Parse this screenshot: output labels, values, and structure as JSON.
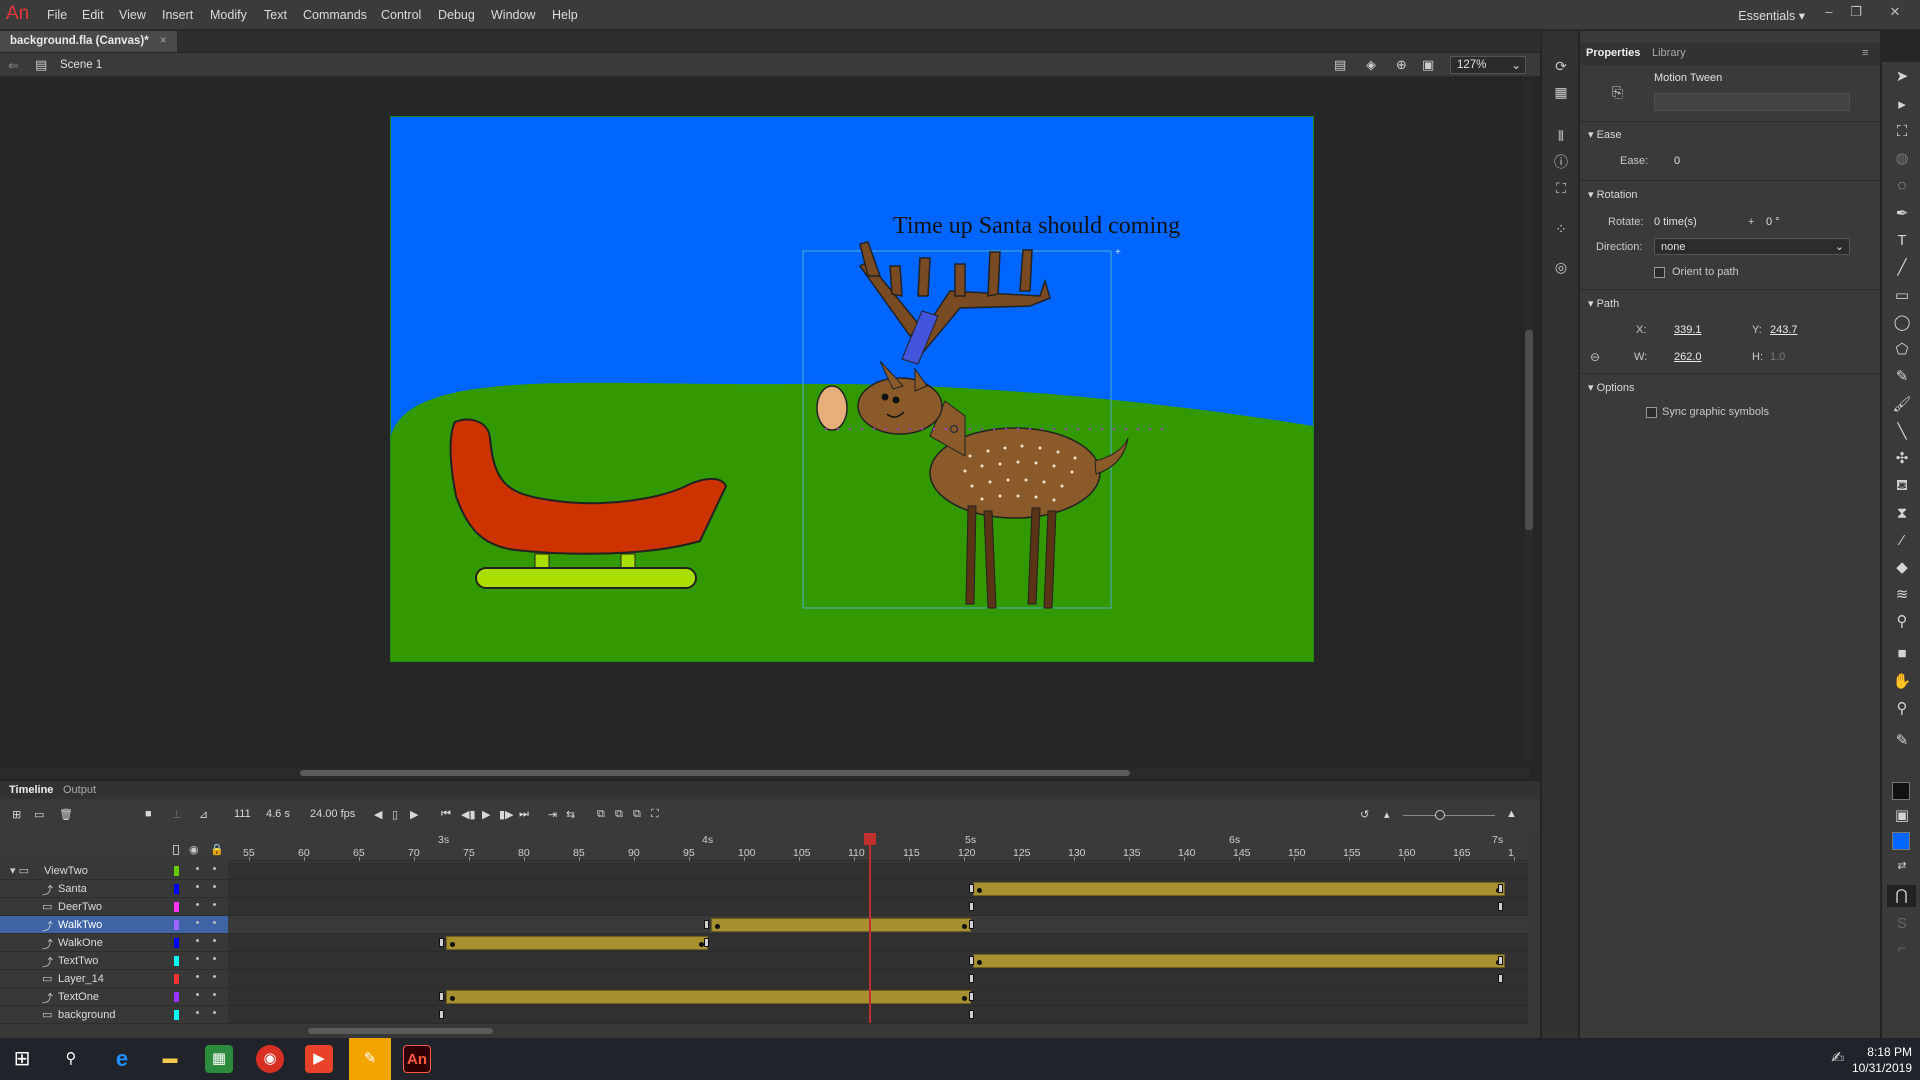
{
  "app": {
    "logo": "An",
    "menu": [
      "File",
      "Edit",
      "View",
      "Insert",
      "Modify",
      "Text",
      "Commands",
      "Control",
      "Debug",
      "Window",
      "Help"
    ],
    "workspace": "Essentials",
    "workspace_caret": "▾"
  },
  "document": {
    "tab_title": "background.fla (Canvas)*",
    "tab_close": "×",
    "scene": "Scene 1",
    "zoom": "127%"
  },
  "stage": {
    "text": "Time up Santa should coming",
    "colors": {
      "sky": "#0066ff",
      "grass": "#339900",
      "sleigh": "#cc3300",
      "runner": "#aadd00",
      "deer": "#8b5a2b",
      "antler": "#6b4423"
    }
  },
  "properties": {
    "tabs": [
      "Properties",
      "Library"
    ],
    "tween_type": "Motion Tween",
    "ease": {
      "section": "Ease",
      "label": "Ease:",
      "value": "0"
    },
    "rotation": {
      "section": "Rotation",
      "rotate_label": "Rotate:",
      "rotate_value": "0 time(s)",
      "plus": "+",
      "degree_value": "0 °",
      "direction_label": "Direction:",
      "direction_value": "none",
      "orient_label": "Orient to path"
    },
    "path": {
      "section": "Path",
      "x_label": "X:",
      "x_value": "339.1",
      "y_label": "Y:",
      "y_value": "243.7",
      "w_label": "W:",
      "w_value": "262.0",
      "h_label": "H:",
      "h_value": "1.0"
    },
    "options": {
      "section": "Options",
      "sync_label": "Sync graphic symbols"
    }
  },
  "timeline": {
    "tabs": [
      "Timeline",
      "Output"
    ],
    "current_frame": "111",
    "elapsed": "4.6 s",
    "fps": "24.00 fps",
    "ruler_numbers": [
      "55",
      "60",
      "65",
      "70",
      "75",
      "80",
      "85",
      "90",
      "95",
      "100",
      "105",
      "110",
      "115",
      "120",
      "125",
      "130",
      "135",
      "140",
      "145",
      "150",
      "155",
      "160",
      "165",
      "1"
    ],
    "ruler_seconds": [
      "3s",
      "4s",
      "5s",
      "6s",
      "7s"
    ],
    "layers": [
      {
        "name": "ViewTwo",
        "type": "folder",
        "color": "#66cc00"
      },
      {
        "name": "Santa",
        "type": "motion",
        "color": "#0000ff"
      },
      {
        "name": "DeerTwo",
        "type": "normal",
        "color": "#ff33ff"
      },
      {
        "name": "WalkTwo",
        "type": "motion",
        "color": "#9966ff",
        "selected": true
      },
      {
        "name": "WalkOne",
        "type": "motion",
        "color": "#0000ff"
      },
      {
        "name": "TextTwo",
        "type": "motion",
        "color": "#00ffff"
      },
      {
        "name": "Layer_14",
        "type": "normal",
        "color": "#ff3333"
      },
      {
        "name": "TextOne",
        "type": "motion",
        "color": "#9933ff"
      },
      {
        "name": "background",
        "type": "normal",
        "color": "#00ffff"
      }
    ]
  },
  "taskbar": {
    "time": "8:18 PM",
    "date": "10/31/2019"
  }
}
